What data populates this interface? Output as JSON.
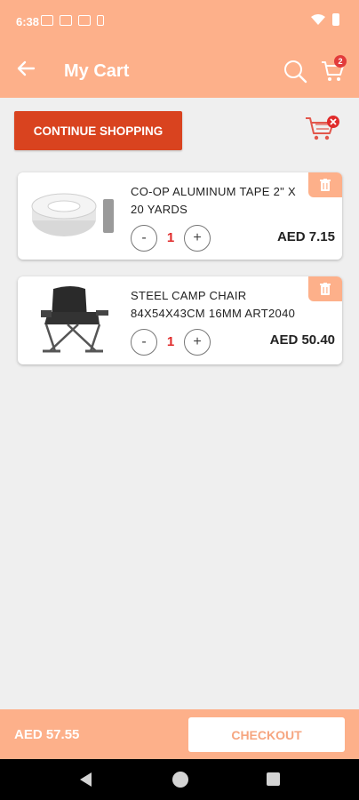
{
  "status": {
    "time": "6:38"
  },
  "app_bar": {
    "title": "My Cart",
    "cart_badge": "2"
  },
  "actions": {
    "continue_label": "CONTINUE SHOPPING"
  },
  "cart_items": [
    {
      "name": "CO-OP ALUMINUM TAPE 2\" X 20 YARDS",
      "qty": "1",
      "minus": "-",
      "plus": "+",
      "price": "AED 7.15"
    },
    {
      "name": "STEEL CAMP CHAIR 84X54X43CM 16MM ART2040",
      "qty": "1",
      "minus": "-",
      "plus": "+",
      "price": "AED 50.40"
    }
  ],
  "footer": {
    "total": "AED 57.55",
    "checkout_label": "CHECKOUT"
  },
  "colors": {
    "accent": "#fdb08a",
    "button": "#d9431f",
    "qty": "#e02b2b"
  }
}
